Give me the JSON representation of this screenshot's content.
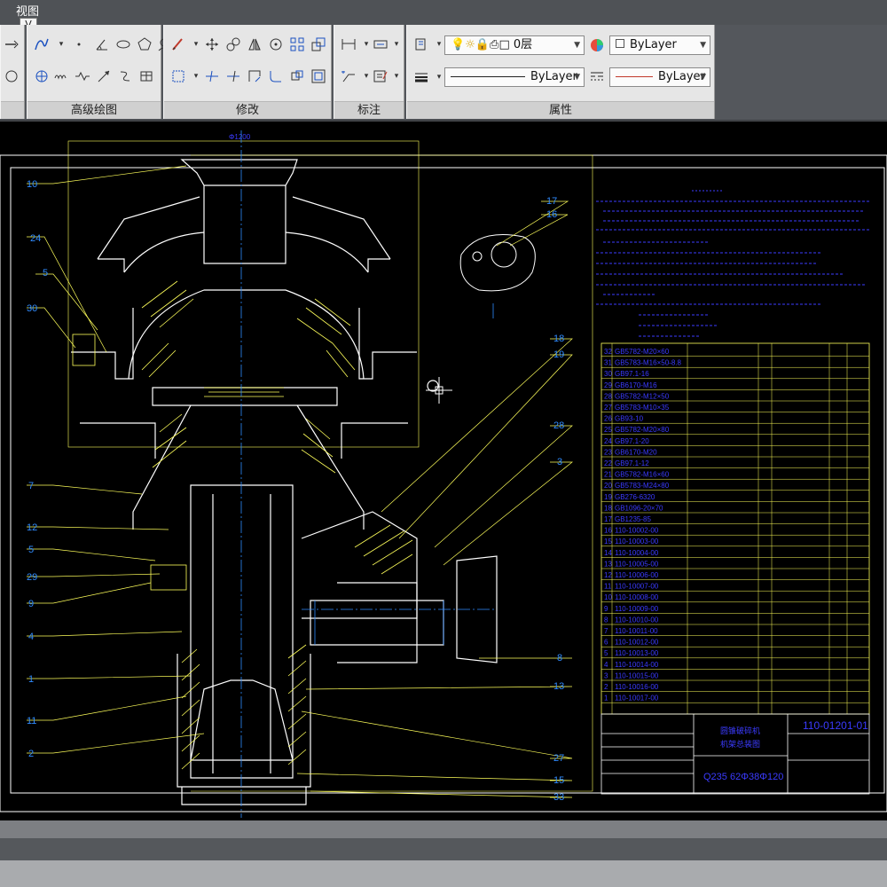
{
  "ribbon": {
    "view_tab_label": "视图",
    "view_key_tip": "V",
    "panels": {
      "advanced_draw": "高级绘图",
      "modify": "修改",
      "annotate": "标注",
      "properties": "属性"
    },
    "layer_value": "0层",
    "color_value": "ByLayer",
    "linetype_value": "ByLayer",
    "lineweight_value": "ByLayer"
  },
  "drawing": {
    "callouts_left": [
      "10",
      "24",
      "5",
      "30",
      "7",
      "12",
      "5",
      "29",
      "9",
      "4",
      "1",
      "11",
      "2"
    ],
    "callouts_right": [
      "17",
      "16",
      "18",
      "19",
      "28",
      "3",
      "8",
      "13",
      "27",
      "15",
      "33"
    ],
    "top_dimension": "Φ1200",
    "title_block": {
      "drawing_number": "110-01201-01",
      "material_note": "Q235 62Φ38Φ120",
      "name_line_1": "圆锥破碎机",
      "name_line_2": "机架总装图"
    },
    "parts_list_rows": [
      "GB5782-M20×60",
      "GB5783-M16×50-8.8",
      "GB97.1-16",
      "GB6170-M16",
      "GB5782-M12×50",
      "GB5783-M10×35",
      "GB93-10",
      "GB5782-M20×80",
      "GB97.1-20",
      "GB6170-M20",
      "GB97.1-12",
      "GB5782-M16×60",
      "GB5783-M24×80",
      "GB276-6320",
      "GB1096-20×70",
      "GB1235-85",
      "110-10002-00",
      "110-10003-00",
      "110-10004-00",
      "110-10005-00",
      "110-10006-00",
      "110-10007-00",
      "110-10008-00",
      "110-10009-00",
      "110-10010-00",
      "110-10011-00",
      "110-10012-00",
      "110-10013-00",
      "110-10014-00",
      "110-10015-00",
      "110-10016-00",
      "110-10017-00"
    ],
    "colors": {
      "background": "#000000",
      "outline": "#ffffff",
      "annotation": "#ffff5a",
      "text": "#3b3bff",
      "hatch": "#ffff5a"
    }
  }
}
